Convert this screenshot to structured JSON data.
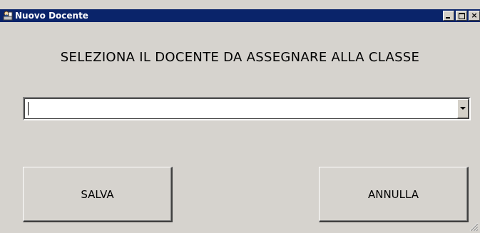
{
  "window": {
    "title": "Nuovo Docente",
    "close_glyph": "×"
  },
  "heading": "SELEZIONA IL DOCENTE DA ASSEGNARE ALLA CLASSE",
  "combo": {
    "value": ""
  },
  "buttons": {
    "save_label": "SALVA",
    "cancel_label": "ANNULLA"
  },
  "icons": {
    "app": "app-icon",
    "minimize": "minimize-icon",
    "maximize": "maximize-icon",
    "close": "close-icon",
    "dropdown": "chevron-down-icon",
    "resize": "resize-grip-icon"
  },
  "colors": {
    "titlebar": "#0a246a",
    "window_bg": "#d6d3ce"
  }
}
